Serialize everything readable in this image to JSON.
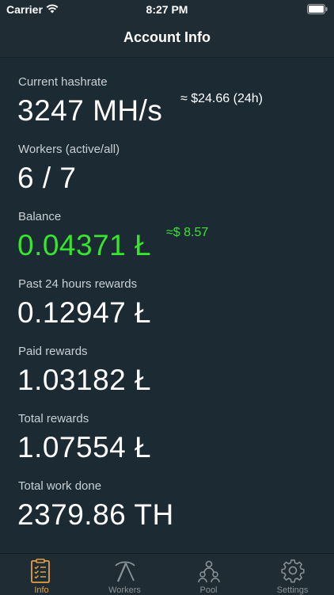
{
  "status_bar": {
    "carrier": "Carrier",
    "time": "8:27 PM"
  },
  "nav": {
    "title": "Account Info"
  },
  "stats": {
    "hashrate": {
      "label": "Current hashrate",
      "value": "3247 MH/s",
      "sub": "≈ $24.66 (24h)"
    },
    "workers": {
      "label": "Workers (active/all)",
      "value": "6 / 7"
    },
    "balance": {
      "label": "Balance",
      "value": "0.04371 Ł",
      "sub": "≈$ 8.57"
    },
    "past24": {
      "label": "Past 24 hours rewards",
      "value": "0.12947 Ł"
    },
    "paid": {
      "label": "Paid rewards",
      "value": "1.03182 Ł"
    },
    "total": {
      "label": "Total rewards",
      "value": "1.07554 Ł"
    },
    "work": {
      "label": "Total work done",
      "value": "2379.86 TH"
    }
  },
  "tabs": [
    {
      "label": "Info",
      "icon": "clipboard-icon"
    },
    {
      "label": "Workers",
      "icon": "pickaxe-icon"
    },
    {
      "label": "Pool",
      "icon": "people-icon"
    },
    {
      "label": "Settings",
      "icon": "gear-icon"
    }
  ],
  "colors": {
    "background": "#1c2a33",
    "accent": "#e4a040",
    "positive": "#37e52f"
  }
}
